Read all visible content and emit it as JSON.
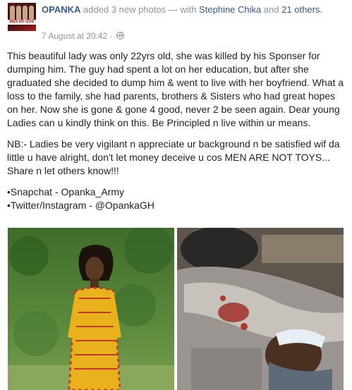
{
  "post": {
    "author": "OPANKA",
    "action": "added 3 new photos",
    "with_prefix": "— with",
    "tagged_person": "Stephine Chika",
    "and_word": "and",
    "others_link": "21 others.",
    "timestamp": "7 August at 20:42",
    "separator": "·",
    "privacy_icon": "globe-icon",
    "avatar_text": "MEN NO GOD",
    "paragraphs": [
      "This beautiful lady was only 22yrs old, she was killed by his Sponser for dumping him. The guy had spent a lot on her education, but after she graduated she decided to dump him & went to live with her boyfriend. What a loss to the family, she had parents, brothers & Sisters who had great hopes on her. Now she is gone & gone 4 good, never 2 be seen again. Dear young Ladies can u kindly think on this. Be Principled n live within ur means.",
      "NB:- Ladies be very vigilant n appreciate ur background n be satisfied wif da little u have alright, don't let money deceive u cos MEN ARE NOT TOYS... Share n let others know!!!"
    ],
    "social": [
      "•Snapchat - Opanka_Army",
      "•Twitter/Instagram - @OpankaGH"
    ]
  },
  "colors": {
    "link": "#365899",
    "meta": "#90949c",
    "text": "#1d2129"
  }
}
